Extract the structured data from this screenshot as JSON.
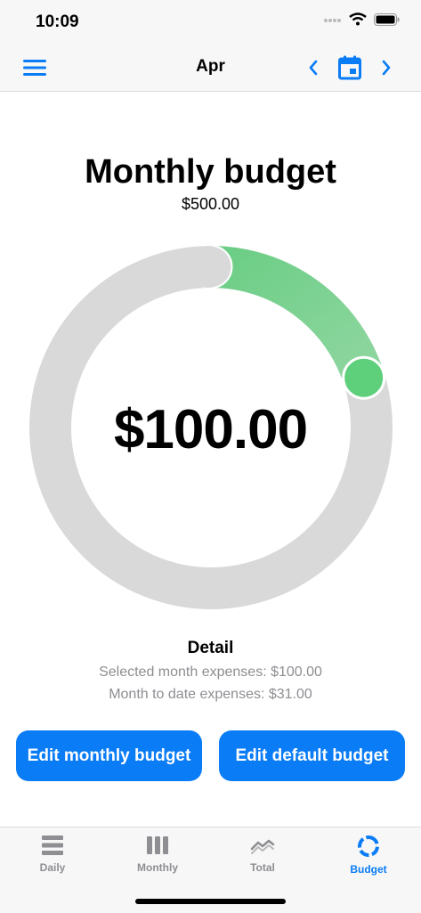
{
  "status": {
    "time": "10:09"
  },
  "nav": {
    "title": "Apr"
  },
  "budget": {
    "title": "Monthly budget",
    "total": "$500.00",
    "amount": "$100.00",
    "fraction": 0.2
  },
  "detail": {
    "title": "Detail",
    "selected_month": "Selected month expenses: $100.00",
    "month_to_date": "Month to date expenses: $31.00"
  },
  "buttons": {
    "edit_monthly": "Edit monthly budget",
    "edit_default": "Edit default budget"
  },
  "tabs": [
    {
      "label": "Daily",
      "icon": "daily-list-icon"
    },
    {
      "label": "Monthly",
      "icon": "monthly-bars-icon"
    },
    {
      "label": "Total",
      "icon": "trend-icon"
    },
    {
      "label": "Budget",
      "icon": "ring-icon",
      "active": true
    }
  ],
  "colors": {
    "accent": "#0a7cf6",
    "progress": "#5ecf7a",
    "track": "#d9d9d9"
  }
}
